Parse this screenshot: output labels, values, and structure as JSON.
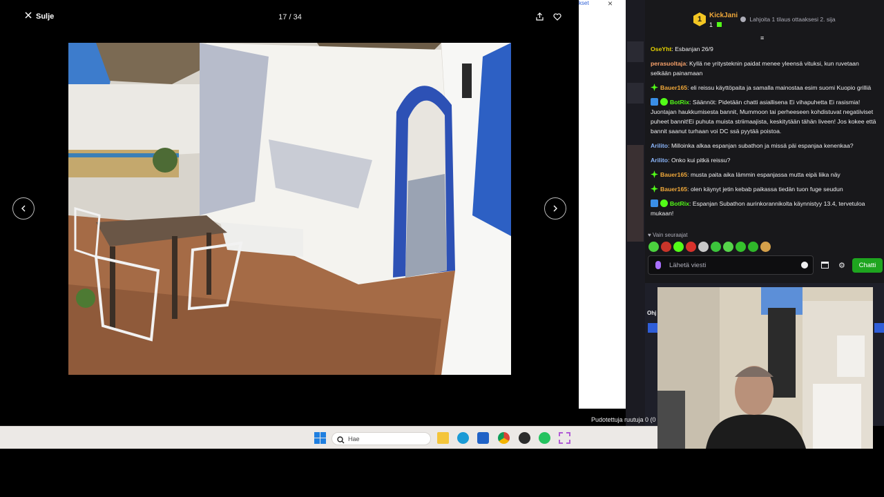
{
  "viewer": {
    "close_label": "Sulje",
    "counter": "17 / 34"
  },
  "browser_fragment": {
    "partial_text": "kset"
  },
  "chat": {
    "top_gifter": {
      "rank": "1",
      "name": "KickJani",
      "count": "1"
    },
    "gift_info": "Lahjoita 1 tilaus ottaaksesi 2. sija",
    "messages": [
      {
        "user": "OseYht",
        "user_color": "#e4d100",
        "text": "Esbanjan 26/9",
        "badges": []
      },
      {
        "user": "perasuoltaja",
        "user_color": "#f7a16a",
        "text": "Kyllä ne yritysteknin paidat menee yleensä vituksi, kun ruvetaan selkään painamaan",
        "badges": []
      },
      {
        "user": "Bauer165",
        "user_color": "#f0a83a",
        "text": "eli reissu käyttöpaita ja samalla mainostaa esim suomi Kuopio grilliä",
        "badges": [
          "star"
        ]
      },
      {
        "user": "BotRix",
        "user_color": "#53fc18",
        "text": "Säännöt: Pidetään chatti asiallisena Ei vihapuhetta Ei rasismia! Juontajan haukkumisesta bannit, Mummoon tai perheeseen kohdistuvat negatiiviset puheet bannit!Ei puhuta muista striimaajista, keskitytään tähän liveen! Jos kokee että bannit saanut turhaan voi DC ssä pyytää poistoa.",
        "badges": [
          "bot",
          "verified"
        ]
      },
      {
        "user": "Arilito",
        "user_color": "#8ab4f8",
        "text": "Milloinka alkaa espanjan subathon ja missä päi espanjaa kenenkaa?",
        "badges": []
      },
      {
        "user": "Arilito",
        "user_color": "#8ab4f8",
        "text": "Onko kui pitkä reissu?",
        "badges": []
      },
      {
        "user": "Bauer165",
        "user_color": "#f0a83a",
        "text": "musta paita aika lämmin espanjassa mutta eipä liika näy",
        "badges": [
          "star"
        ]
      },
      {
        "user": "Bauer165",
        "user_color": "#f0a83a",
        "text": "olen käynyt jetin kebab paikassa tiedän tuon fuge seudun",
        "badges": [
          "star"
        ]
      },
      {
        "user": "BotRix",
        "user_color": "#53fc18",
        "text": "Espanjan Subathon aurinkorannikolta käynnistyy 13.4, tervetuloa mukaan!",
        "badges": [
          "bot",
          "verified"
        ]
      }
    ],
    "followers_only": "Vain seuraajat",
    "input_placeholder": "Lähetä viesti",
    "send_label": "Chatti"
  },
  "stream": {
    "dropped_frames": "Pudotettuja ruutuja 0 (0",
    "obs_label": "Ohj"
  },
  "taskbar": {
    "search_placeholder": "Hae"
  },
  "colors": {
    "kick_green": "#53fc18",
    "chat_bg": "#18181b",
    "send_button": "#1ea51f"
  }
}
